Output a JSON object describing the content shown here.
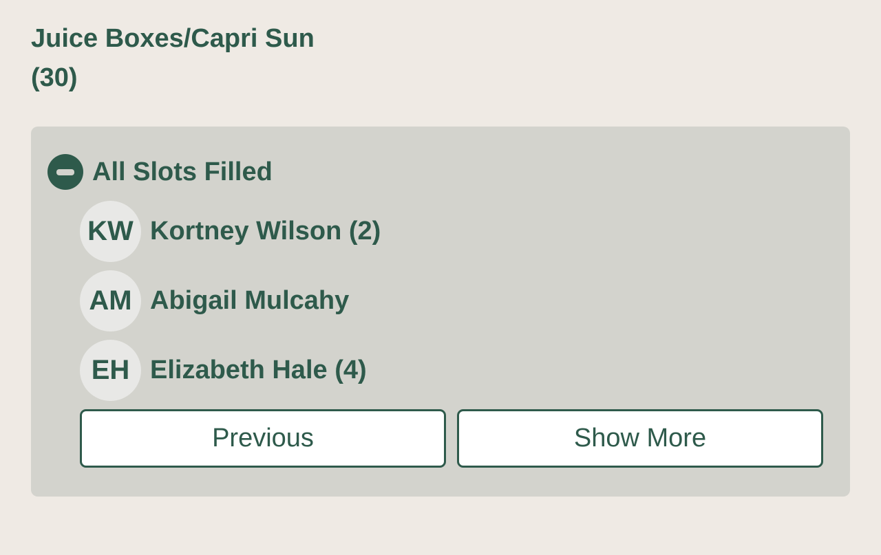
{
  "item": {
    "title_line1": "Juice Boxes/Capri Sun",
    "title_line2": "(30)"
  },
  "status": {
    "icon": "minus-circle-icon",
    "label": "All Slots Filled"
  },
  "volunteers": [
    {
      "initials": "KW",
      "name": "Kortney Wilson (2)"
    },
    {
      "initials": "AM",
      "name": "Abigail Mulcahy"
    },
    {
      "initials": "EH",
      "name": "Elizabeth Hale (4)"
    }
  ],
  "buttons": {
    "previous_label": "Previous",
    "show_more_label": "Show More"
  },
  "colors": {
    "background": "#efeae4",
    "panel": "#d3d3cd",
    "accent": "#2e5a4b",
    "avatar": "#e8e8e6",
    "button_bg": "#ffffff"
  }
}
